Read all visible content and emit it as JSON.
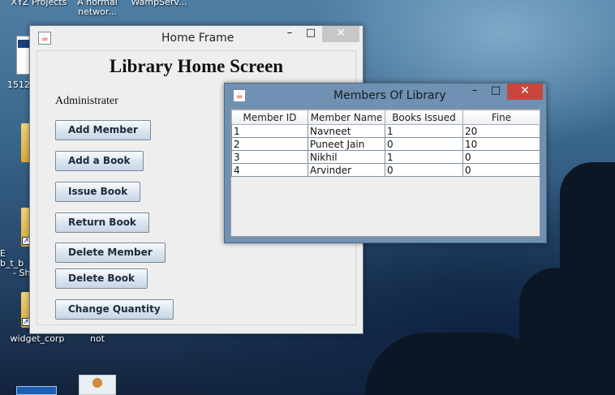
{
  "desktop": {
    "icons": [
      {
        "label_line1": "XYZ Projects",
        "label_line2": ""
      },
      {
        "label_line1": "A normal",
        "label_line2": "networ..."
      },
      {
        "label_line1": "WampServ...",
        "label_line2": ""
      },
      {
        "label_line1": "1512",
        "label_line2": ""
      },
      {
        "label_line1": "E  b_t_b",
        "label_line2": "- Sh"
      },
      {
        "label_line1": "widget_corp",
        "label_line2": ""
      },
      {
        "label_line1": "not",
        "label_line2": ""
      }
    ]
  },
  "home_frame": {
    "title": "Home Frame",
    "heading": "Library Home Screen",
    "role_label": "Administrater",
    "buttons": {
      "add_member": "Add Member",
      "add_book": "Add a Book",
      "issue_book": "Issue Book",
      "return_book": "Return Book",
      "delete_member": "Delete Member",
      "delete_book": "Delete Book",
      "change_quantity": "Change Quantity"
    },
    "controls": {
      "minimize": "–",
      "maximize": "□",
      "close": "✕"
    }
  },
  "members_window": {
    "title": "Members Of Library",
    "controls": {
      "minimize": "–",
      "maximize": "□",
      "close": "✕"
    },
    "columns": [
      "Member ID",
      "Member Name",
      "Books Issued",
      "Fine"
    ],
    "rows": [
      [
        "1",
        "Navneet",
        "1",
        "20"
      ],
      [
        "2",
        "Puneet Jain",
        "0",
        "10"
      ],
      [
        "3",
        "Nikhil",
        "1",
        "0"
      ],
      [
        "4",
        "Arvinder",
        "0",
        "0"
      ]
    ]
  },
  "colors": {
    "close_button_active": "#c9463d",
    "button_gradient_bottom": "#c7d6e5",
    "window_bg": "#eeeeee"
  }
}
